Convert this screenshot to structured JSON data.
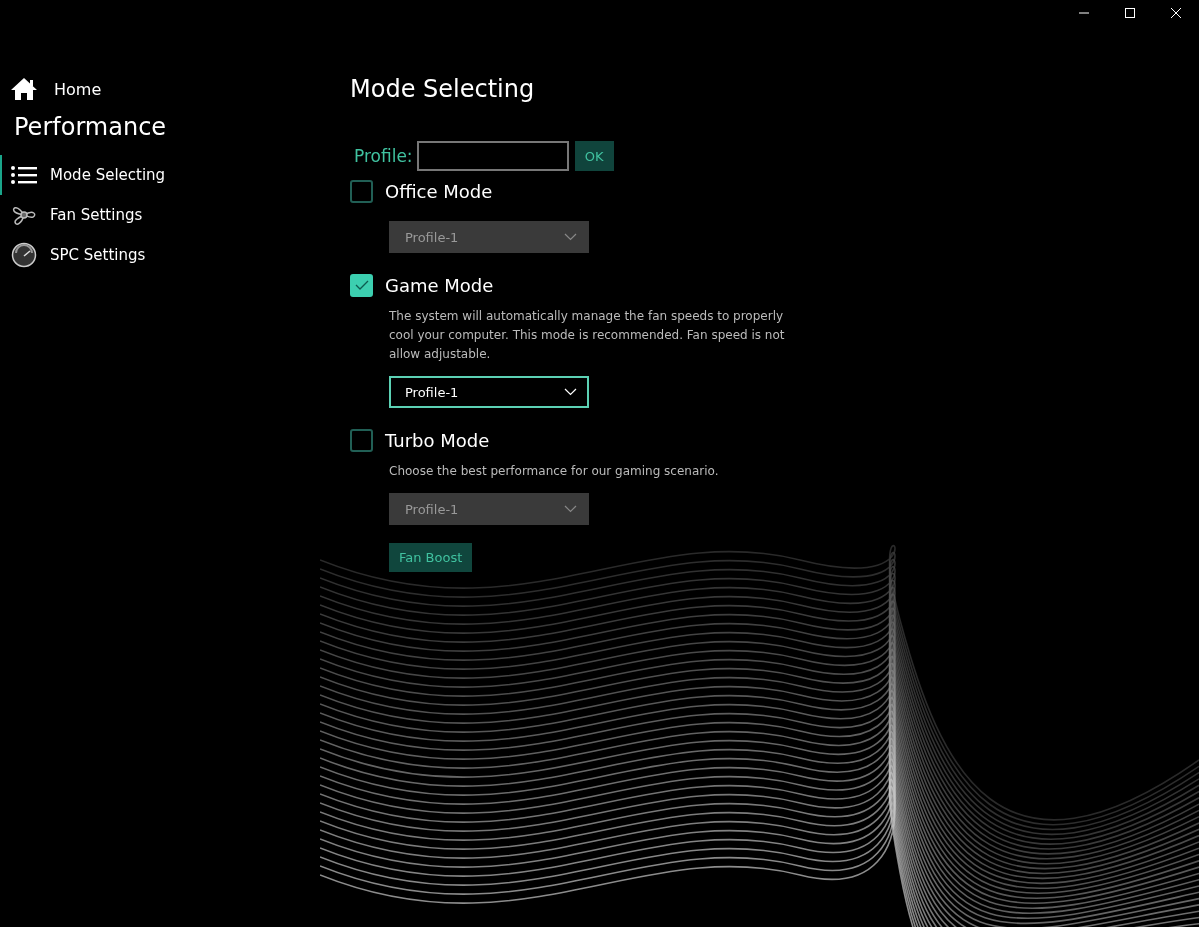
{
  "sidebar": {
    "home": {
      "label": "Home"
    },
    "section": "Performance",
    "items": [
      {
        "label": "Mode Selecting",
        "selected": true
      },
      {
        "label": "Fan Settings",
        "selected": false
      },
      {
        "label": "SPC Settings",
        "selected": false
      }
    ]
  },
  "page": {
    "title": "Mode Selecting",
    "profile": {
      "label": "Profile:",
      "button": "OK"
    },
    "modes": [
      {
        "name": "Office Mode",
        "checked": false,
        "dropdown": {
          "value": "Profile-1",
          "disabled": true
        }
      },
      {
        "name": "Game Mode",
        "checked": true,
        "description": "The system will automatically manage the fan speeds to properly cool your computer.  This mode is recommended. Fan speed is not allow adjustable.",
        "dropdown": {
          "value": "Profile-1",
          "disabled": false
        }
      },
      {
        "name": "Turbo Mode",
        "checked": false,
        "description": "Choose the best performance for our gaming scenario.",
        "dropdown": {
          "value": "Profile-1",
          "disabled": true
        }
      }
    ],
    "fan_boost": "Fan Boost"
  }
}
